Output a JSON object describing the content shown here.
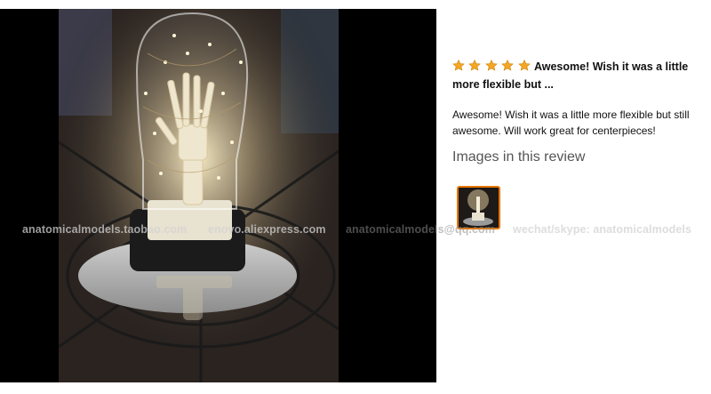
{
  "review": {
    "rating": 5,
    "rating_max": 5,
    "star_color": "#f5a623",
    "star_icon": "star-icon",
    "headline": "Awesome! Wish it was a little more flexible but ...",
    "body": "Awesome! Wish it was a little more flexible but still awesome. Will work great for centerpieces!",
    "images_heading": "Images in this review"
  },
  "watermarks": [
    "anatomicalmodels.taobao.com",
    "enovo.aliexpress.com",
    "anatomicalmodels@qq.com",
    "wechat/skype: anatomicalmodels"
  ],
  "colors": {
    "viewer_background": "#000000",
    "thumbnail_border": "#e77600"
  }
}
